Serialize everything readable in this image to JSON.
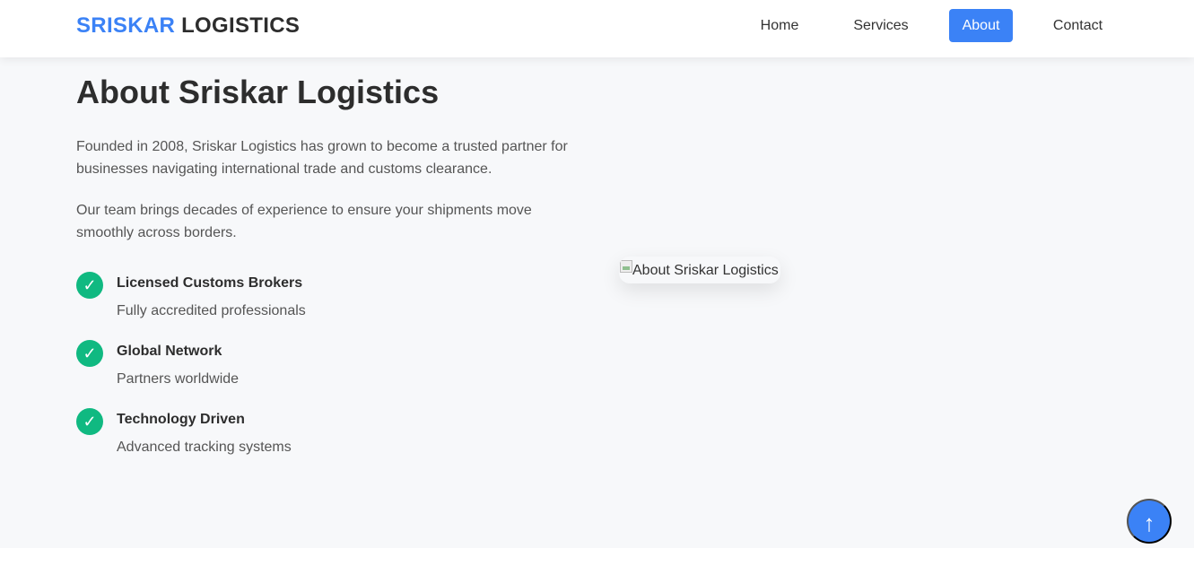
{
  "header": {
    "logo": {
      "brand": "SRISKAR",
      "rest": " LOGISTICS"
    },
    "nav": [
      {
        "label": "Home",
        "active": false
      },
      {
        "label": "Services",
        "active": false
      },
      {
        "label": "About",
        "active": true
      },
      {
        "label": "Contact",
        "active": false
      }
    ]
  },
  "about": {
    "title": "About Sriskar Logistics",
    "paragraphs": [
      "Founded in 2008, Sriskar Logistics has grown to become a trusted partner for businesses navigating international trade and customs clearance.",
      "Our team brings decades of experience to ensure your shipments move smoothly across borders."
    ],
    "features": [
      {
        "icon": "check-icon",
        "symbol": "✓",
        "title": "Licensed Customs Brokers",
        "description": "Fully accredited professionals"
      },
      {
        "icon": "check-icon",
        "symbol": "✓",
        "title": "Global Network",
        "description": "Partners worldwide"
      },
      {
        "icon": "check-icon",
        "symbol": "✓",
        "title": "Technology Driven",
        "description": "Advanced tracking systems"
      }
    ],
    "image": {
      "alt": "About Sriskar Logistics"
    }
  },
  "scroll_top": {
    "icon": "arrow-up-icon",
    "symbol": "↑"
  },
  "colors": {
    "accent": "#3b82f6",
    "success": "#10b981",
    "background": "#f7f8fa",
    "text": "#2d2d2d",
    "muted": "#555555"
  }
}
